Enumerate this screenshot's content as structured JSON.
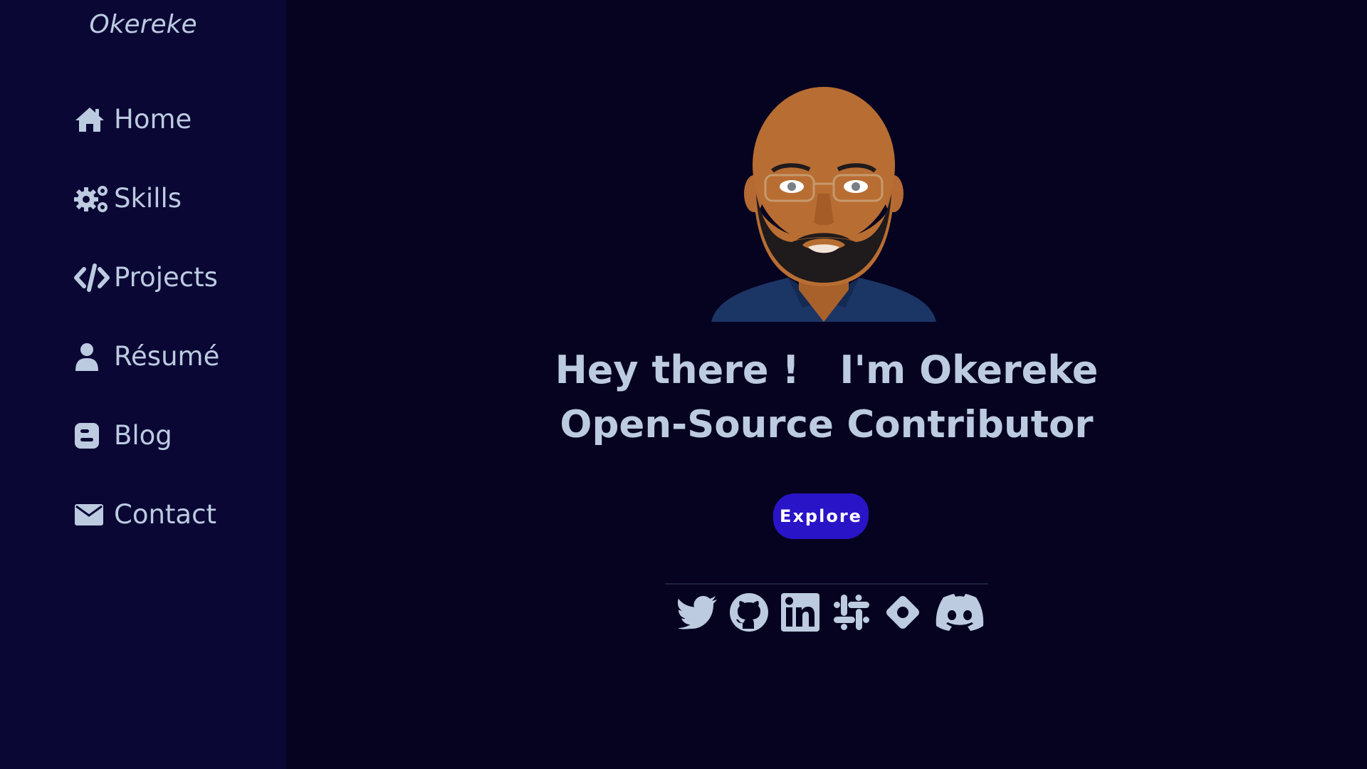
{
  "sidebar": {
    "brand": "Okereke",
    "items": [
      {
        "label": "Home",
        "icon": "home-icon"
      },
      {
        "label": "Skills",
        "icon": "gears-icon"
      },
      {
        "label": "Projects",
        "icon": "code-icon"
      },
      {
        "label": "Résumé",
        "icon": "user-icon"
      },
      {
        "label": "Blog",
        "icon": "blogger-icon"
      },
      {
        "label": "Contact",
        "icon": "envelope-icon"
      }
    ]
  },
  "hero": {
    "greeting": "Hey there !   I'm Okereke",
    "role": "Open-Source Contributor",
    "button_label": "Explore"
  },
  "socials": [
    {
      "icon": "twitter-icon"
    },
    {
      "icon": "github-icon"
    },
    {
      "icon": "linkedin-icon"
    },
    {
      "icon": "slack-icon"
    },
    {
      "icon": "diamond-icon"
    },
    {
      "icon": "discord-icon"
    }
  ],
  "colors": {
    "background": "#060320",
    "sidebar": "#0a0735",
    "text": "#bccbe0",
    "button": "#2a14c8"
  }
}
